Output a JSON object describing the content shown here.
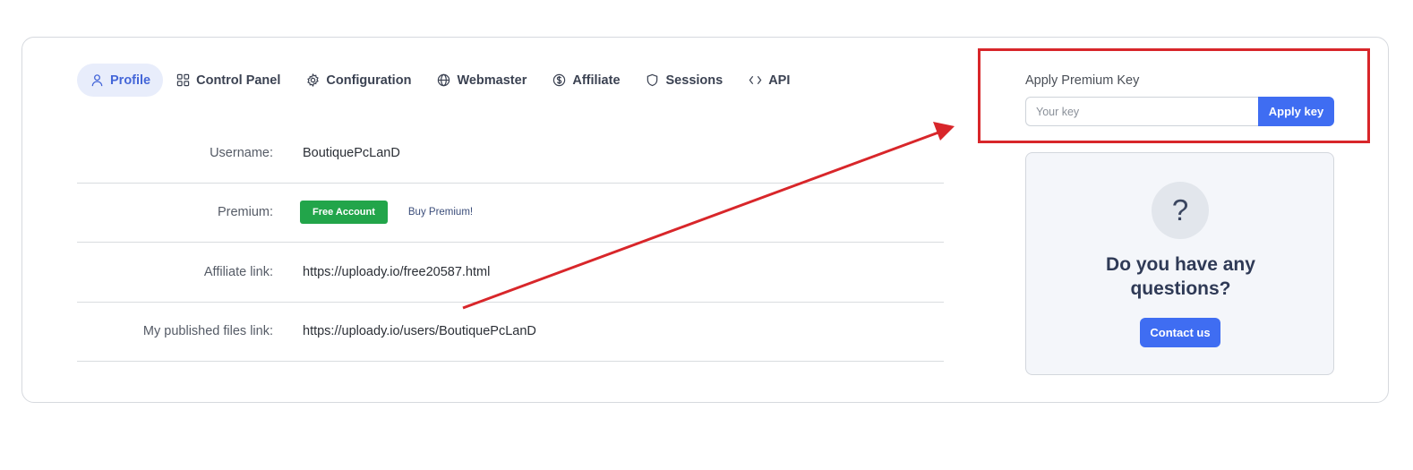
{
  "tabs": [
    {
      "label": "Profile",
      "icon": "user-icon",
      "active": true
    },
    {
      "label": "Control Panel",
      "icon": "grid-icon"
    },
    {
      "label": "Configuration",
      "icon": "gear-icon"
    },
    {
      "label": "Webmaster",
      "icon": "globe-icon"
    },
    {
      "label": "Affiliate",
      "icon": "dollar-icon"
    },
    {
      "label": "Sessions",
      "icon": "shield-icon"
    },
    {
      "label": "API",
      "icon": "code-icon"
    }
  ],
  "profile": {
    "username_label": "Username:",
    "username_value": "BoutiquePcLanD",
    "premium_label": "Premium:",
    "premium_badge": "Free Account",
    "buy_premium": "Buy Premium!",
    "affiliate_label": "Affiliate link:",
    "affiliate_value": "https://uploady.io/free20587.html",
    "files_label": "My published files link:",
    "files_value": "https://uploady.io/users/BoutiquePcLanD"
  },
  "premium_key": {
    "title": "Apply Premium Key",
    "placeholder": "Your key",
    "button": "Apply key"
  },
  "questions": {
    "icon": "?",
    "line1": "Do you have any",
    "line2": "questions?",
    "button": "Contact us"
  },
  "colors": {
    "accent": "#3f6df2",
    "badge_green": "#22a54a",
    "annotation_red": "#d8262a"
  }
}
